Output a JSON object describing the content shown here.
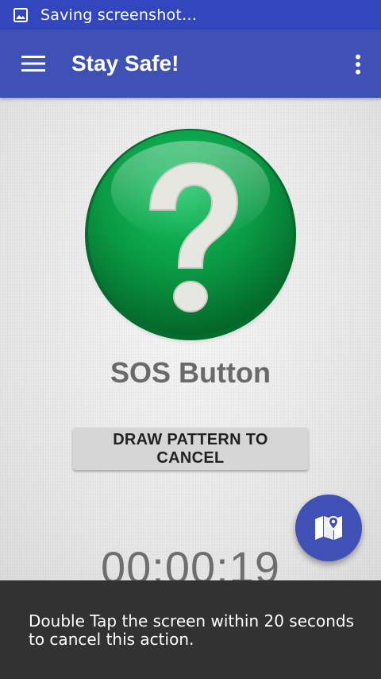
{
  "status_bar": {
    "icon": "image-icon",
    "text": "Saving screenshot…"
  },
  "app_bar": {
    "menu_icon": "hamburger-menu-icon",
    "title": "Stay Safe!",
    "overflow_icon": "more-vert-icon"
  },
  "main": {
    "sos_icon": "question-mark-icon",
    "sos_label": "SOS Button",
    "cancel_button_label": "DRAW PATTERN TO CANCEL",
    "timer": "00:00:19",
    "fab_icon": "map-icon"
  },
  "snackbar": {
    "message": "Double Tap the screen within 20 seconds to cancel this action."
  },
  "colors": {
    "status_bar": "#3246bd",
    "app_bar": "#3f51b5",
    "sos_green": "#0a9a44",
    "snackbar": "#323232"
  }
}
